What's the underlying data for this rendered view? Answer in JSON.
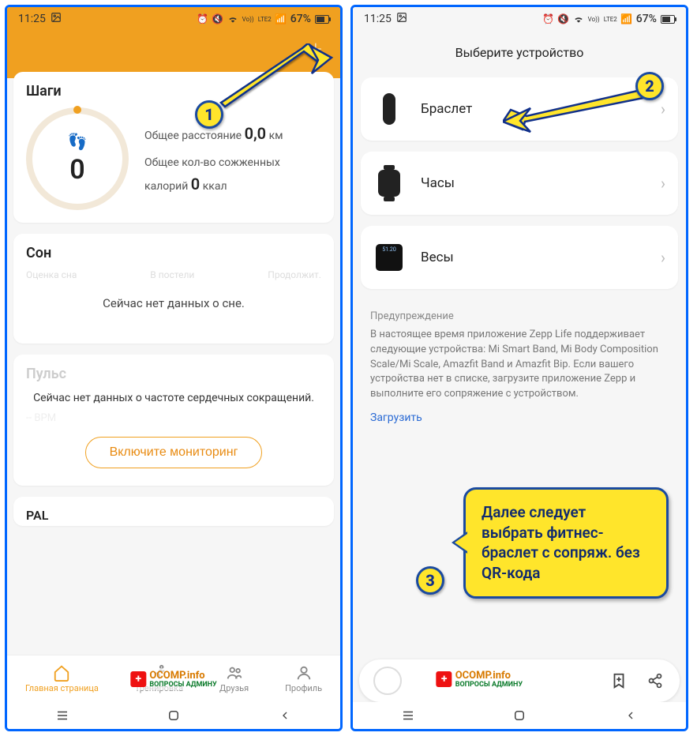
{
  "status": {
    "time": "11:25",
    "battery": "67%",
    "lte": "LTE2",
    "vo": "Vo))"
  },
  "left": {
    "steps": {
      "title": "Шаги",
      "count": "0",
      "distance_label": "Общее расстояние",
      "distance_value": "0,0",
      "distance_unit": "км",
      "calories_label": "Общее кол-во сожженных калорий",
      "calories_value": "0",
      "calories_unit": "ккал"
    },
    "sleep": {
      "title": "Сон",
      "col1": "Оценка сна",
      "col2": "В постели",
      "col3": "Продолжит.",
      "msg": "Сейчас нет данных о сне."
    },
    "pulse": {
      "title": "Пульс",
      "msg": "Сейчас нет данных о частоте сердечных сокращений.",
      "bpm": "-- BPM",
      "button": "Включите мониторинг"
    },
    "pal": {
      "title": "PAL"
    },
    "nav": {
      "home": "Главная страница",
      "workout": "Тренировка",
      "friends": "Друзья",
      "profile": "Профиль"
    }
  },
  "right": {
    "title": "Выберите устройство",
    "devices": {
      "band": "Браслет",
      "watch": "Часы",
      "scale": "Весы"
    },
    "warning_title": "Предупреждение",
    "warning_text": "В настоящее время приложение Zepp Life поддерживает следующие устройства: Mi Smart Band, Mi Body Composition Scale/Mi Scale, Amazfit Band и Amazfit Bip. Если вашего устройства нет в списке, загрузите приложение Zepp и выполните его сопряжение с устройством.",
    "download": "Загрузить"
  },
  "watermark": {
    "line1": "OCOMP.info",
    "line2": "ВОПРОСЫ АДМИНУ"
  },
  "annotations": {
    "m1": "1",
    "m2": "2",
    "m3": "3",
    "callout": "Далее следует выбрать фитнес-браслет с сопряж. без QR-кода"
  }
}
